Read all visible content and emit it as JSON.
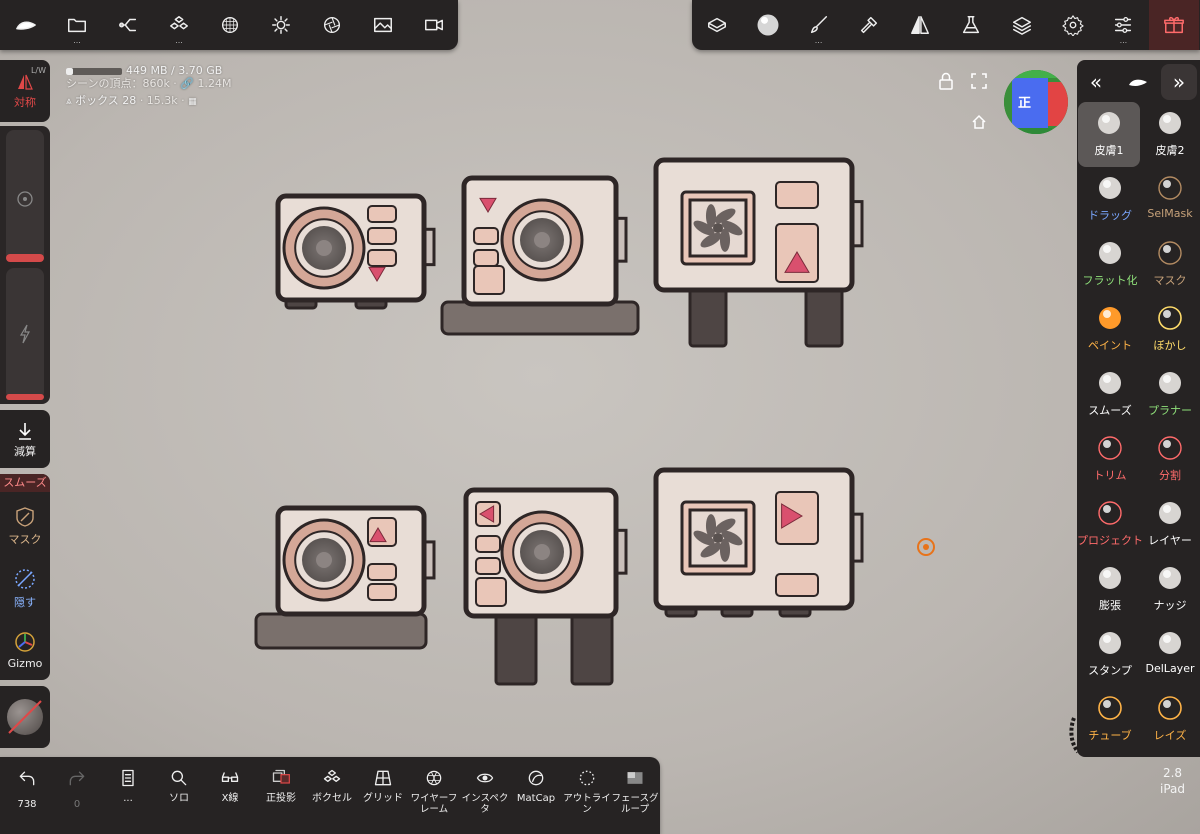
{
  "top_toolbar_left": {
    "items": [
      {
        "name": "app-logo",
        "icon": "slug-logo-icon",
        "more": ""
      },
      {
        "name": "files",
        "icon": "folder-icon",
        "more": "..."
      },
      {
        "name": "scene",
        "icon": "scene-graph-icon",
        "more": ""
      },
      {
        "name": "meshes",
        "icon": "mesh-stack-icon",
        "more": "..."
      },
      {
        "name": "topology",
        "icon": "topology-icon",
        "more": ""
      },
      {
        "name": "lighting",
        "icon": "sun-icon",
        "more": ""
      },
      {
        "name": "post-process",
        "icon": "aperture-icon",
        "more": ""
      },
      {
        "name": "background",
        "icon": "image-icon",
        "more": ""
      },
      {
        "name": "camera",
        "icon": "video-camera-icon",
        "more": ""
      }
    ]
  },
  "top_toolbar_right": {
    "items": [
      {
        "name": "stroke-settings",
        "icon": "brush-box-icon",
        "more": ""
      },
      {
        "name": "material",
        "icon": "matcap-sphere-icon",
        "more": ""
      },
      {
        "name": "painting",
        "icon": "paint-brush-icon",
        "more": "..."
      },
      {
        "name": "tool-settings",
        "icon": "hammer-icon",
        "more": ""
      },
      {
        "name": "symmetry",
        "icon": "symmetry-icon",
        "more": ""
      },
      {
        "name": "experimental",
        "icon": "flask-icon",
        "more": ""
      },
      {
        "name": "layers",
        "icon": "layers-icon",
        "more": ""
      },
      {
        "name": "settings",
        "icon": "gear-icon",
        "more": ""
      },
      {
        "name": "interface",
        "icon": "sliders-icon",
        "more": "..."
      },
      {
        "name": "gift",
        "icon": "gift-icon",
        "more": ""
      }
    ]
  },
  "hud": {
    "memory": "449 MB / 3.70 GB",
    "memory_used_fraction": 0.12,
    "scene_vertices": "シーンの頂点：860k · 🔗 1.24M",
    "object_name": "ボックス 28",
    "object_vertices": "· 15.3k ·"
  },
  "left_column": {
    "symmetry": {
      "label": "対称",
      "tag": "L/W"
    },
    "subtract": {
      "label": "減算"
    },
    "smooth_header": "スムーズ",
    "mask": {
      "label": "マスク"
    },
    "hide": {
      "label": "隠す"
    },
    "gizmo": {
      "label": "Gizmo"
    },
    "radius_fraction": 0.25,
    "intensity_fraction": 0.0
  },
  "right_panel": {
    "tools": [
      {
        "name": "skin1",
        "label": "皮膚1",
        "color": "#ffffff",
        "selected": true
      },
      {
        "name": "skin2",
        "label": "皮膚2",
        "color": "#ffffff",
        "selected": false
      },
      {
        "name": "drag",
        "label": "ドラッグ",
        "color": "#7aa7ff",
        "selected": false
      },
      {
        "name": "selmask",
        "label": "SelMask",
        "color": "#c7a27a",
        "selected": false
      },
      {
        "name": "flatten",
        "label": "フラット化",
        "color": "#8fe07a",
        "selected": false
      },
      {
        "name": "mask",
        "label": "マスク",
        "color": "#c7a27a",
        "selected": false
      },
      {
        "name": "paint",
        "label": "ペイント",
        "color": "#ffb347",
        "selected": false
      },
      {
        "name": "blur",
        "label": "ぼかし",
        "color": "#ffdc6a",
        "selected": false
      },
      {
        "name": "smooth",
        "label": "スムーズ",
        "color": "#ffffff",
        "selected": false
      },
      {
        "name": "planar",
        "label": "プラナー",
        "color": "#8fe07a",
        "selected": false
      },
      {
        "name": "trim",
        "label": "トリム",
        "color": "#ff6b6b",
        "selected": false
      },
      {
        "name": "split",
        "label": "分割",
        "color": "#ff6b6b",
        "selected": false
      },
      {
        "name": "project",
        "label": "プロジェクト",
        "color": "#ff6b6b",
        "selected": false
      },
      {
        "name": "layer",
        "label": "レイヤー",
        "color": "#ffffff",
        "selected": false
      },
      {
        "name": "inflate",
        "label": "膨張",
        "color": "#ffffff",
        "selected": false
      },
      {
        "name": "nudge",
        "label": "ナッジ",
        "color": "#ffffff",
        "selected": false
      },
      {
        "name": "stamp",
        "label": "スタンプ",
        "color": "#ffffff",
        "selected": false
      },
      {
        "name": "dellayer",
        "label": "DelLayer",
        "color": "#ffffff",
        "selected": false
      },
      {
        "name": "tube",
        "label": "チューブ",
        "color": "#ffb347",
        "selected": false
      },
      {
        "name": "lathe",
        "label": "レイズ",
        "color": "#ffb347",
        "selected": false
      }
    ]
  },
  "bottom_toolbar": {
    "items": [
      {
        "name": "undo",
        "label": "738",
        "icon": "undo-icon"
      },
      {
        "name": "redo",
        "label": "0",
        "icon": "redo-icon"
      },
      {
        "name": "history",
        "label": "...",
        "icon": "history-icon"
      },
      {
        "name": "solo",
        "label": "ソロ",
        "icon": "search-icon"
      },
      {
        "name": "xray",
        "label": "X線",
        "icon": "glasses-icon"
      },
      {
        "name": "ortho",
        "label": "正投影",
        "icon": "ortho-cube-icon"
      },
      {
        "name": "voxel",
        "label": "ボクセル",
        "icon": "voxel-icon"
      },
      {
        "name": "grid",
        "label": "グリッド",
        "icon": "grid-icon"
      },
      {
        "name": "wireframe",
        "label": "ワイヤーフレーム",
        "icon": "wireframe-icon"
      },
      {
        "name": "inspector",
        "label": "インスペクタ",
        "icon": "inspector-icon"
      },
      {
        "name": "matcap",
        "label": "MatCap",
        "icon": "matcap-icon"
      },
      {
        "name": "outline",
        "label": "アウトライン",
        "icon": "outline-icon"
      },
      {
        "name": "facegroup",
        "label": "フェースグループ",
        "icon": "facegroup-icon"
      }
    ]
  },
  "view_cube": {
    "face_label": "正"
  },
  "version": {
    "number": "2.8",
    "device": "iPad"
  },
  "colors": {
    "panel": "#262323",
    "accent_red": "#e04848",
    "unit_body": "#e8ddd6",
    "unit_outline": "#2e2626",
    "unit_pink": "#e9c6b8",
    "arrow_pink": "#d9506e",
    "pivot_orange": "#e8731a"
  }
}
